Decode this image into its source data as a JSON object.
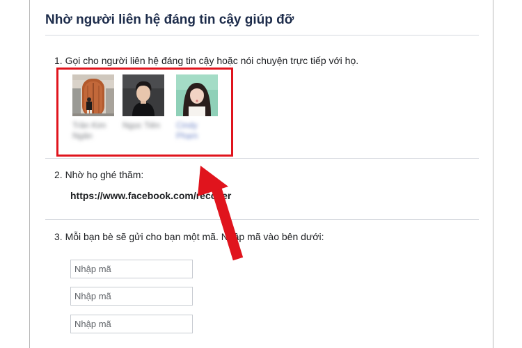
{
  "dialog": {
    "title": "Nhờ người liên hệ đáng tin cậy giúp đỡ"
  },
  "step1": {
    "text": "1. Gọi cho người liên hệ đáng tin cậy hoặc nói chuyện trực tiếp với họ.",
    "contacts": [
      {
        "name": "Trần Kim Ngân"
      },
      {
        "name": "Ngọc Tiên"
      },
      {
        "name": "Cindy Phạm"
      }
    ]
  },
  "step2": {
    "text": "2. Nhờ họ ghé thăm:",
    "link": "https://www.facebook.com/recover"
  },
  "step3": {
    "text": "3. Mỗi bạn bè sẽ gửi cho bạn một mã. Nhập mã vào bên dưới:",
    "inputs": [
      {
        "placeholder": "Nhập mã",
        "value": ""
      },
      {
        "placeholder": "Nhập mã",
        "value": ""
      },
      {
        "placeholder": "Nhập mã",
        "value": ""
      }
    ]
  },
  "colors": {
    "title": "#1c2b4a",
    "highlight": "#e0141d",
    "arrow": "#e0141d"
  }
}
